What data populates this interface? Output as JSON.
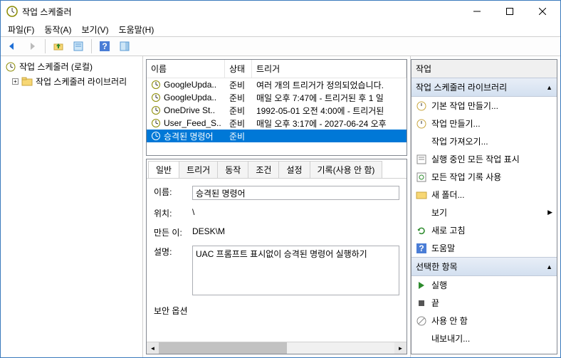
{
  "window": {
    "title": "작업 스케줄러"
  },
  "menu": {
    "file": "파일(F)",
    "action": "동작(A)",
    "view": "보기(V)",
    "help": "도움말(H)"
  },
  "tree": {
    "root": "작업 스케줄러 (로컬)",
    "library": "작업 스케줄러 라이브러리"
  },
  "task_columns": {
    "name": "이름",
    "state": "상태",
    "trigger": "트리거"
  },
  "tasks": [
    {
      "name": "GoogleUpda..",
      "state": "준비",
      "trigger": "여러 개의 트리거가 정의되었습니다."
    },
    {
      "name": "GoogleUpda..",
      "state": "준비",
      "trigger": "매일 오후 7:47에 - 트리거된 후 1 일"
    },
    {
      "name": "OneDrive St..",
      "state": "준비",
      "trigger": "1992-05-01 오전 4:00에 - 트리거된 "
    },
    {
      "name": "User_Feed_S..",
      "state": "준비",
      "trigger": "매일 오후 3:17에 - 2027-06-24 오후"
    },
    {
      "name": "승격된 명령어",
      "state": "준비",
      "trigger": ""
    }
  ],
  "detail_tabs": {
    "general": "일반",
    "triggers": "트리거",
    "actions": "동작",
    "conditions": "조건",
    "settings": "설정",
    "history": "기록(사용 안 함)"
  },
  "detail": {
    "name_label": "이름:",
    "name_value": "승격된 명령어",
    "location_label": "위치:",
    "location_value": "\\",
    "author_label": "만든 이:",
    "author_value": "DESK\\M",
    "desc_label": "설명:",
    "desc_value": "UAC 프롬프트 표시없이 승격된 명령어 실행하기",
    "security_label": "보안 옵션"
  },
  "actions_pane": {
    "header": "작업",
    "section1": "작업 스케줄러 라이브러리",
    "items1": {
      "create_basic": "기본 작업 만들기...",
      "create": "작업 만들기...",
      "import": "작업 가져오기...",
      "show_running": "실행 중인 모든 작업 표시",
      "enable_history": "모든 작업 기록 사용",
      "new_folder": "새 폴더...",
      "view": "보기",
      "refresh": "새로 고침",
      "help": "도움말"
    },
    "section2": "선택한 항목",
    "items2": {
      "run": "실행",
      "end": "끝",
      "disable": "사용 안 함",
      "export": "내보내기..."
    }
  }
}
